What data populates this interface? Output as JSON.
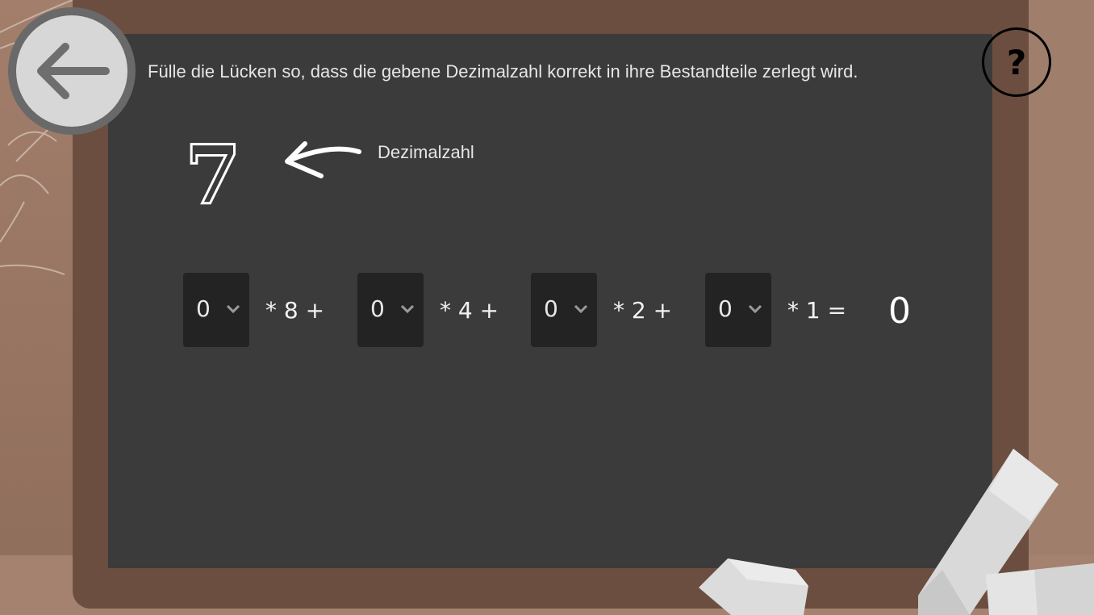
{
  "instruction": "Fülle die Lücken so, dass die gebene Dezimalzahl korrekt in ihre Bestandteile zerlegt wird.",
  "decimal_number": "7",
  "decimal_label": "Dezimalzahl",
  "help_label": "?",
  "equation": {
    "selects": [
      {
        "value": "0"
      },
      {
        "value": "0"
      },
      {
        "value": "0"
      },
      {
        "value": "0"
      }
    ],
    "operators": [
      "* 8 +",
      "* 4 +",
      "* 2 +",
      "* 1 ="
    ],
    "result": "0"
  },
  "icons": {
    "back": "arrow-left-icon",
    "help": "question-icon",
    "dropdown": "chevron-down-icon"
  },
  "colors": {
    "board": "#3b3b3b",
    "frame": "#6b4e3f",
    "background": "#9c7a68",
    "select_bg": "#232323"
  }
}
